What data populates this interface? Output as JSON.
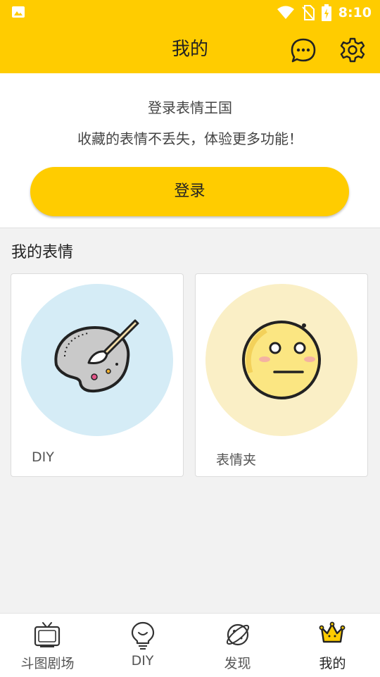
{
  "status_bar": {
    "time": "8:10"
  },
  "header": {
    "title": "我的"
  },
  "login_panel": {
    "line1": "登录表情王国",
    "line2": "收藏的表情不丢失，体验更多功能！",
    "login_button": "登录"
  },
  "my_emoticons": {
    "title": "我的表情",
    "cards": [
      {
        "label": "DIY",
        "icon": "palette-icon",
        "bg_color": "#d5ecf6"
      },
      {
        "label": "表情夹",
        "icon": "neutral-face-icon",
        "bg_color": "#faefc6"
      }
    ]
  },
  "tab_bar": {
    "tabs": [
      {
        "label": "斗图剧场",
        "icon": "tv-icon"
      },
      {
        "label": "DIY",
        "icon": "lightbulb-icon"
      },
      {
        "label": "发现",
        "icon": "planet-icon"
      },
      {
        "label": "我的",
        "icon": "crown-icon",
        "active": true
      }
    ]
  },
  "colors": {
    "accent": "#ffcc00",
    "background": "#f2f2f2"
  }
}
